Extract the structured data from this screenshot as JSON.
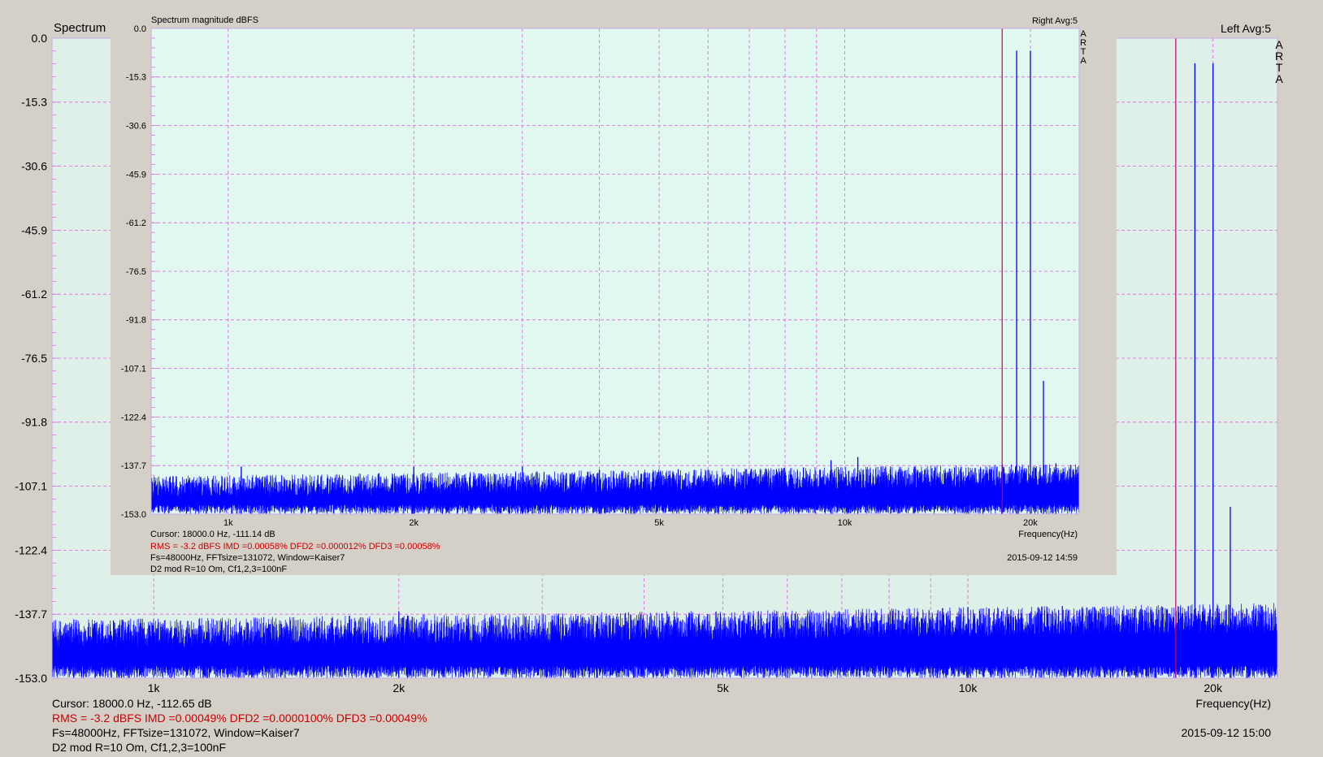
{
  "colors": {
    "background": "#d4d0c8",
    "plot_bg_main": "#dff0e8",
    "plot_bg_inset": "#e0f8f0",
    "grid": "#e060e0",
    "trace": "#0000ff",
    "cursor": "#c00060",
    "stats_text": "#cc0000"
  },
  "main": {
    "title": "Spectrum",
    "channel": "Left  Avg:5",
    "arta": [
      "A",
      "R",
      "T",
      "A"
    ],
    "xlabel": "Frequency(Hz)",
    "cursor": "Cursor: 18000.0 Hz, -112.65 dB",
    "stats": "RMS =   -3.2 dBFS   IMD =0.00049%   DFD2 =0.0000100%   DFD3 =0.00049%",
    "settings": "Fs=48000Hz, FFTsize=131072, Window=Kaiser7",
    "note": "D2 mod R=10 Om, Cf1,2,3=100nF",
    "timestamp": "2015-09-12  15:00"
  },
  "inset": {
    "title": "Spectrum magnitude dBFS",
    "channel": "Right  Avg:5",
    "arta": [
      "A",
      "R",
      "T",
      "A"
    ],
    "xlabel": "Frequency(Hz)",
    "cursor": "Cursor: 18000.0 Hz, -111.14 dB",
    "stats": "RMS =   -3.2 dBFS   IMD =0.00058%   DFD2 =0.000012%   DFD3 =0.00058%",
    "settings": "Fs=48000Hz, FFTsize=131072, Window=Kaiser7",
    "note": "D2 mod R=10 Om, Cf1,2,3=100nF",
    "timestamp": "2015-09-12  14:59"
  },
  "chart_data": [
    {
      "type": "line",
      "name": "main",
      "x_scale": "log",
      "xlim": [
        750,
        24000
      ],
      "ylim": [
        -153.0,
        0.0
      ],
      "y_ticks": [
        "0.0",
        "-15.3",
        "-30.6",
        "-45.9",
        "-61.2",
        "-76.5",
        "-91.8",
        "-107.1",
        "-122.4",
        "-137.7",
        "-153.0"
      ],
      "x_ticks": [
        {
          "value": 1000,
          "label": "1k"
        },
        {
          "value": 2000,
          "label": "2k"
        },
        {
          "value": 5000,
          "label": "5k"
        },
        {
          "value": 10000,
          "label": "10k"
        },
        {
          "value": 20000,
          "label": "20k"
        }
      ],
      "cursor_hz": 18000,
      "noise_floor_db": [
        -148,
        -144
      ],
      "peaks": [
        {
          "x": 19000,
          "y": -6
        },
        {
          "x": 20000,
          "y": -6
        },
        {
          "x": 21000,
          "y": -112
        },
        {
          "x": 2000,
          "y": -137
        },
        {
          "x": 2050,
          "y": -138
        },
        {
          "x": 10000,
          "y": -136
        },
        {
          "x": 11000,
          "y": -137
        },
        {
          "x": 17000,
          "y": -139
        },
        {
          "x": 22000,
          "y": -141
        },
        {
          "x": 18000,
          "y": -140
        },
        {
          "x": 3500,
          "y": -140
        },
        {
          "x": 1050,
          "y": -141
        },
        {
          "x": 1150,
          "y": -142
        },
        {
          "x": 4000,
          "y": -142
        }
      ]
    },
    {
      "type": "line",
      "name": "inset",
      "x_scale": "log",
      "xlim": [
        750,
        24000
      ],
      "ylim": [
        -153.0,
        0.0
      ],
      "y_ticks": [
        "0.0",
        "-15.3",
        "-30.6",
        "-45.9",
        "-61.2",
        "-76.5",
        "-91.8",
        "-107.1",
        "-122.4",
        "-137.7",
        "-153.0"
      ],
      "x_ticks": [
        {
          "value": 1000,
          "label": "1k"
        },
        {
          "value": 2000,
          "label": "2k"
        },
        {
          "value": 5000,
          "label": "5k"
        },
        {
          "value": 10000,
          "label": "10k"
        },
        {
          "value": 20000,
          "label": "20k"
        }
      ],
      "cursor_hz": 18000,
      "noise_floor_db": [
        -150,
        -146
      ],
      "peaks": [
        {
          "x": 19000,
          "y": -7
        },
        {
          "x": 20000,
          "y": -7
        },
        {
          "x": 21000,
          "y": -111
        },
        {
          "x": 2000,
          "y": -138
        },
        {
          "x": 3000,
          "y": -138
        },
        {
          "x": 9500,
          "y": -136
        },
        {
          "x": 10500,
          "y": -135
        },
        {
          "x": 18000,
          "y": -138
        },
        {
          "x": 22000,
          "y": -137
        },
        {
          "x": 1050,
          "y": -138
        },
        {
          "x": 4000,
          "y": -139
        },
        {
          "x": 6000,
          "y": -139
        }
      ]
    }
  ]
}
